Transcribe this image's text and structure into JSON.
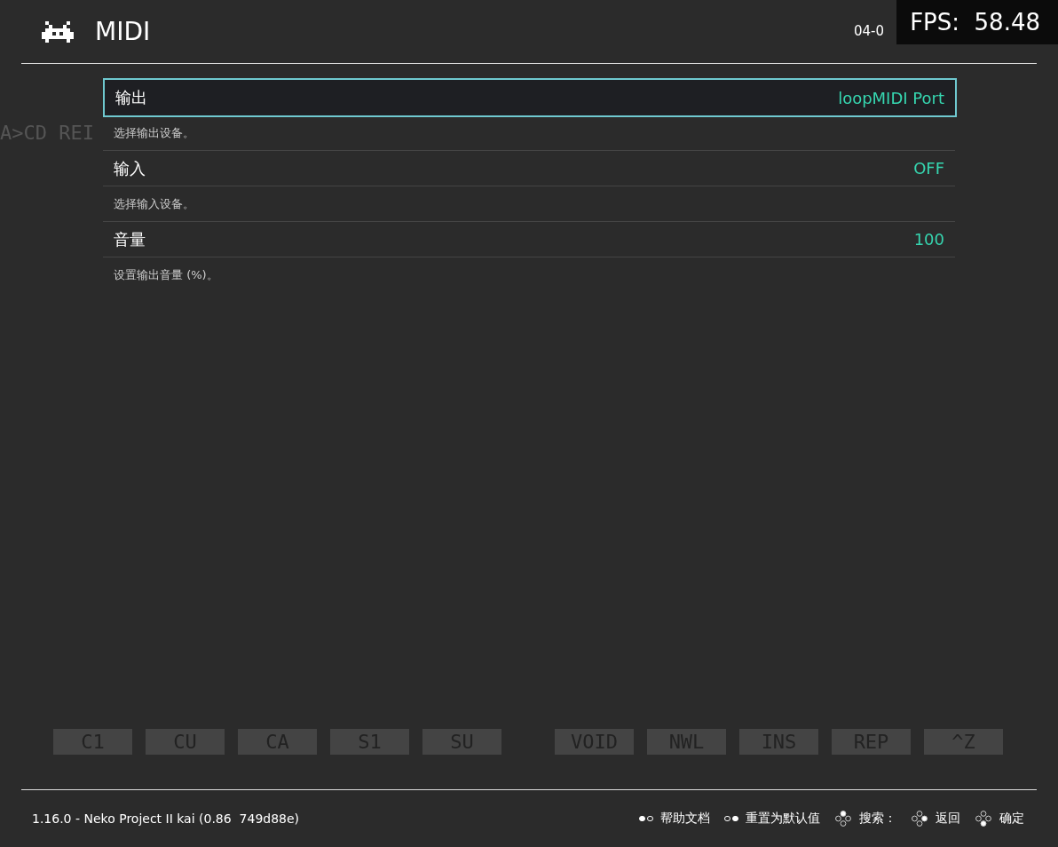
{
  "header": {
    "title": "MIDI",
    "clock": "04-0",
    "fps": "FPS:  58.48"
  },
  "background_text": "A>CD REI",
  "items": [
    {
      "label": "输出",
      "value": "loopMIDI Port",
      "description": "选择输出设备。",
      "selected": true
    },
    {
      "label": "输入",
      "value": "OFF",
      "description": "选择输入设备。",
      "selected": false
    },
    {
      "label": "音量",
      "value": "100",
      "description": "设置输出音量 (%)。",
      "selected": false
    }
  ],
  "key_groups": [
    [
      "C1",
      "CU",
      "CA",
      "S1",
      "SU"
    ],
    [
      "VOID",
      "NWL",
      "INS",
      "REP",
      "^Z"
    ]
  ],
  "footer": {
    "version": "1.16.0 - Neko Project II kai (0.86  749d88e)",
    "hints": [
      {
        "kind": "select",
        "label": "帮助文档"
      },
      {
        "kind": "start",
        "label": "重置为默认值"
      },
      {
        "kind": "top",
        "label": "搜索："
      },
      {
        "kind": "right",
        "label": "返回"
      },
      {
        "kind": "bottom",
        "label": "确定"
      }
    ]
  }
}
